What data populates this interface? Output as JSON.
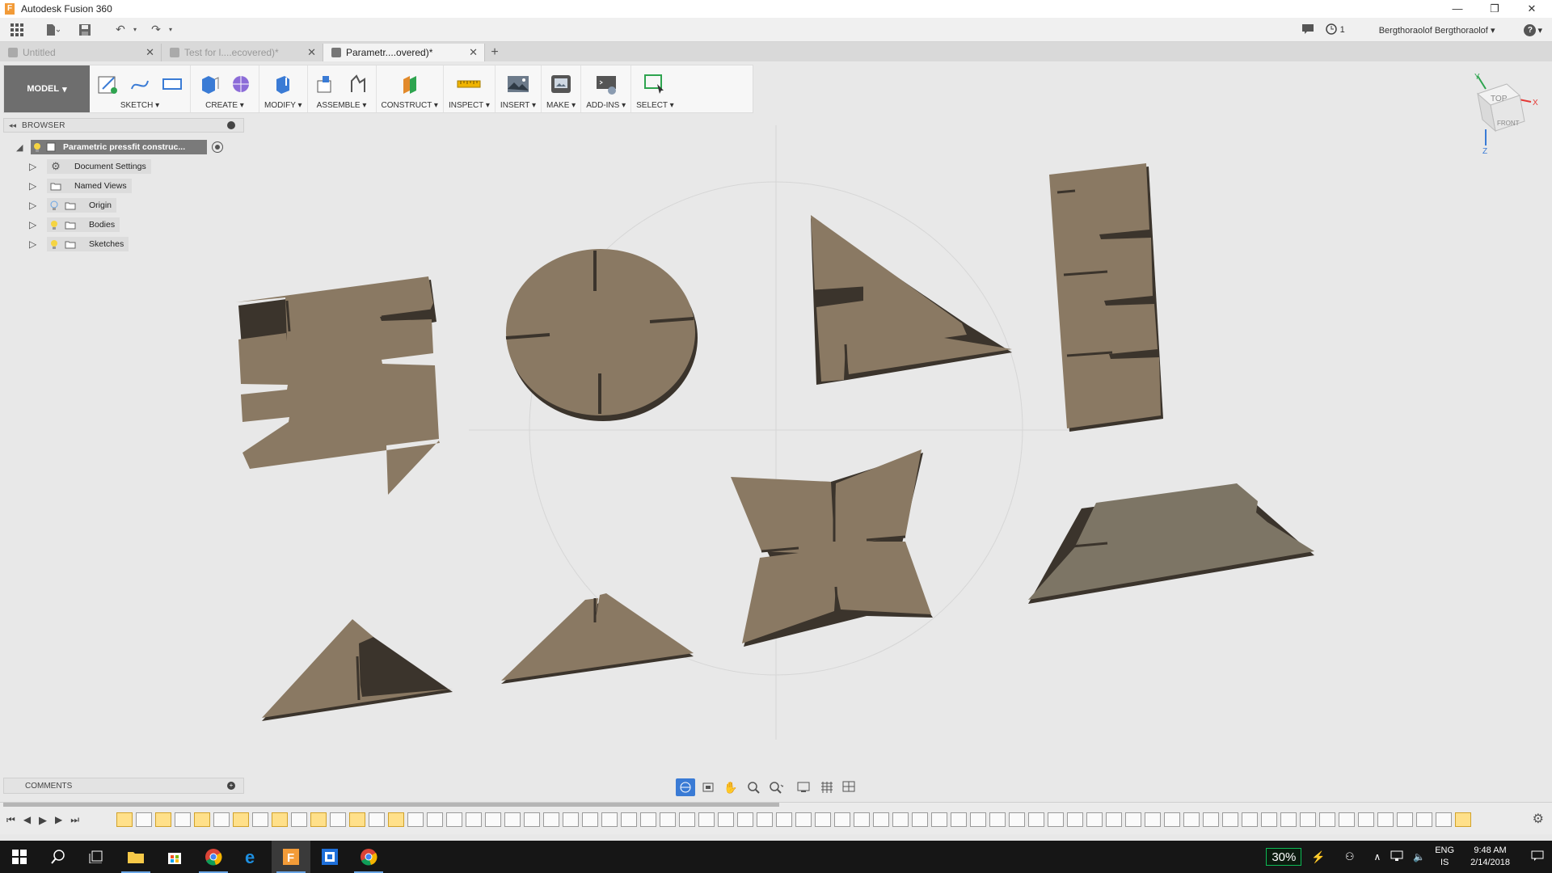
{
  "window": {
    "title": "Autodesk Fusion 360"
  },
  "account": {
    "user": "Bergthoraolof Bergthoraolof",
    "job_status_count": "1",
    "help_label": "?"
  },
  "tabs": [
    {
      "label": "Untitled",
      "active": false
    },
    {
      "label": "Test for l....ecovered)*",
      "active": false
    },
    {
      "label": "Parametr....overed)*",
      "active": true
    }
  ],
  "toolbar": {
    "workspace": "MODEL",
    "groups": [
      {
        "label": "SKETCH",
        "icons": [
          "create-sketch-icon",
          "spline-icon",
          "rectangle-icon"
        ]
      },
      {
        "label": "CREATE",
        "icons": [
          "extrude-icon",
          "form-icon"
        ]
      },
      {
        "label": "MODIFY",
        "icons": [
          "press-pull-icon"
        ]
      },
      {
        "label": "ASSEMBLE",
        "icons": [
          "new-component-icon",
          "joint-icon"
        ]
      },
      {
        "label": "CONSTRUCT",
        "icons": [
          "offset-plane-icon"
        ]
      },
      {
        "label": "INSPECT",
        "icons": [
          "measure-icon"
        ]
      },
      {
        "label": "INSERT",
        "icons": [
          "insert-image-icon"
        ]
      },
      {
        "label": "MAKE",
        "icons": [
          "3d-print-icon"
        ]
      },
      {
        "label": "ADD-INS",
        "icons": [
          "scripts-icon"
        ]
      },
      {
        "label": "SELECT",
        "icons": [
          "window-select-icon"
        ]
      }
    ]
  },
  "browser": {
    "header": "BROWSER",
    "root": "Parametric pressfit construc...",
    "items": [
      {
        "label": "Document Settings",
        "icon": "gear-icon"
      },
      {
        "label": "Named Views",
        "icon": "folder-icon"
      },
      {
        "label": "Origin",
        "icon": "folder-icon"
      },
      {
        "label": "Bodies",
        "icon": "folder-icon"
      },
      {
        "label": "Sketches",
        "icon": "folder-icon"
      }
    ]
  },
  "comments": {
    "header": "COMMENTS"
  },
  "viewcube": {
    "top": "TOP",
    "front": "FRONT",
    "x": "X",
    "y": "Y",
    "z": "Z"
  },
  "colors": {
    "part": "#8a7963",
    "part_dark": "#3b342c",
    "accent": "#1e88e5"
  },
  "taskbar": {
    "battery": "30%",
    "lang": "ENG",
    "region": "IS",
    "time": "9:48 AM",
    "date": "2/14/2018"
  }
}
